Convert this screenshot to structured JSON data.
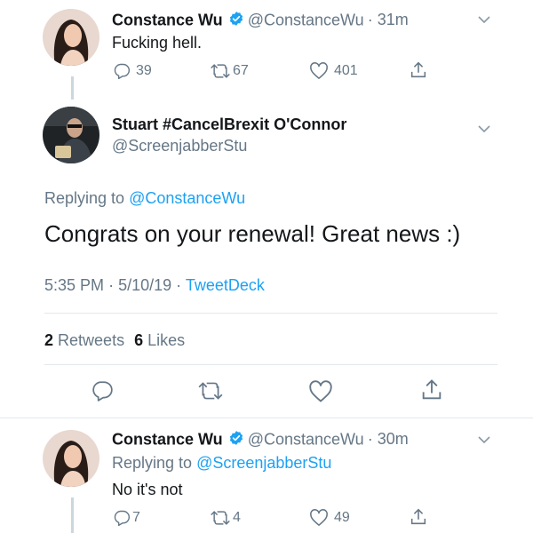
{
  "tweet1": {
    "author_name": "Constance Wu",
    "handle": "@ConstanceWu",
    "time": "· 31m",
    "text": "Fucking hell.",
    "replies": "39",
    "retweets": "67",
    "likes": "401"
  },
  "main_tweet": {
    "author_name": "Stuart #CancelBrexit O'Connor",
    "handle": "@ScreenjabberStu",
    "replying_prefix": "Replying to",
    "replying_to": "@ConstanceWu",
    "text": "Congrats on your renewal! Great news :)",
    "time": "5:35 PM",
    "date_sep": "·",
    "date": "5/10/19",
    "source_sep": "·",
    "source": "TweetDeck",
    "retweets_count": "2",
    "retweets_label": "Retweets",
    "likes_count": "6",
    "likes_label": "Likes"
  },
  "tweet3": {
    "author_name": "Constance Wu",
    "handle": "@ConstanceWu",
    "time": "· 30m",
    "replying_prefix": "Replying to",
    "replying_to": "@ScreenjabberStu",
    "text": "No it's not",
    "replies": "7",
    "retweets": "4",
    "likes": "49"
  },
  "colors": {
    "accent": "#1da1f2",
    "muted": "#657786",
    "text": "#14171a",
    "divider": "#e1e8ed"
  },
  "icons": [
    "reply-icon",
    "retweet-icon",
    "like-icon",
    "share-icon",
    "chevron-down-icon",
    "verified-badge-icon"
  ]
}
